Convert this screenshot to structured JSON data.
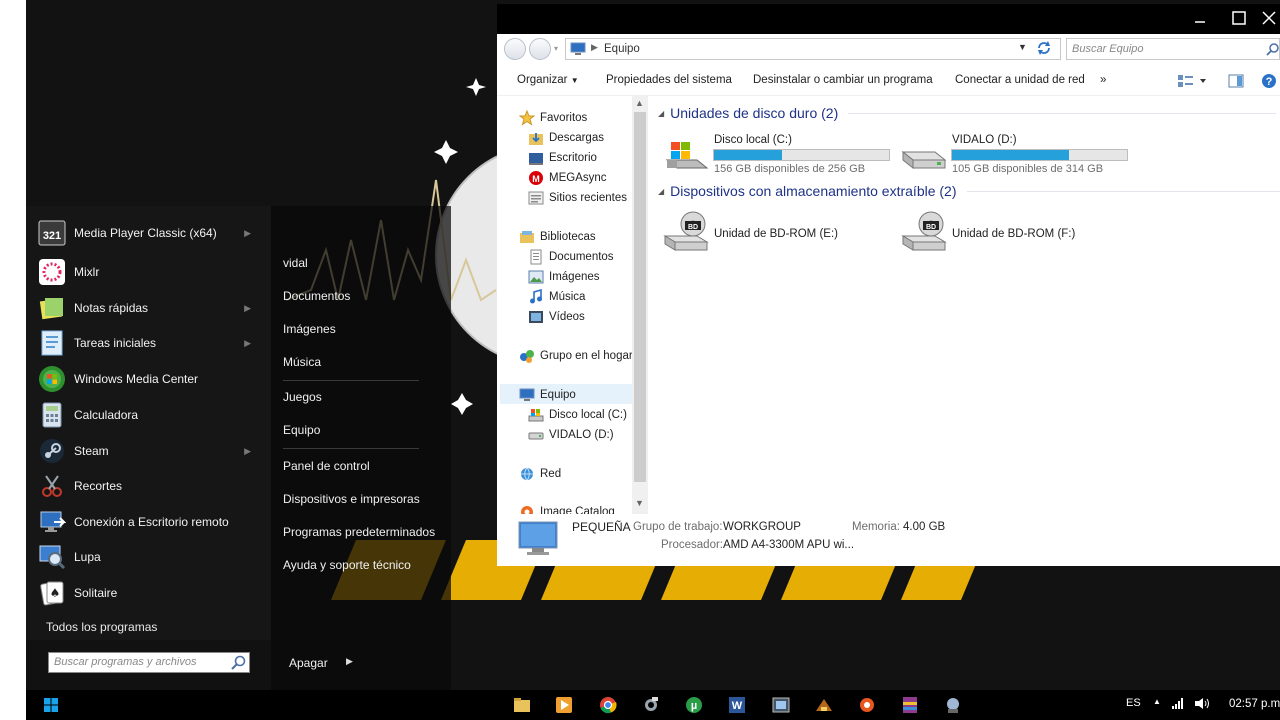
{
  "start_menu": {
    "programs": [
      {
        "label": "Media Player Classic (x64)",
        "icon": "media-player-classic-icon",
        "has_submenu": true
      },
      {
        "label": "Mixlr",
        "icon": "mixlr-icon",
        "has_submenu": false
      },
      {
        "label": "Notas rápidas",
        "icon": "sticky-notes-icon",
        "has_submenu": true
      },
      {
        "label": "Tareas iniciales",
        "icon": "getting-started-icon",
        "has_submenu": true
      },
      {
        "label": "Windows Media Center",
        "icon": "windows-media-center-icon",
        "has_submenu": false
      },
      {
        "label": "Calculadora",
        "icon": "calculator-icon",
        "has_submenu": false
      },
      {
        "label": "Steam",
        "icon": "steam-icon",
        "has_submenu": true
      },
      {
        "label": "Recortes",
        "icon": "snipping-tool-icon",
        "has_submenu": false
      },
      {
        "label": "Conexión a Escritorio remoto",
        "icon": "remote-desktop-icon",
        "has_submenu": false
      },
      {
        "label": "Lupa",
        "icon": "magnifier-icon",
        "has_submenu": false
      },
      {
        "label": "Solitaire",
        "icon": "solitaire-icon",
        "has_submenu": false
      }
    ],
    "all_programs": "Todos los programas",
    "search_placeholder": "Buscar programas y archivos",
    "places": [
      "vidal",
      "Documentos",
      "Imágenes",
      "Música",
      "Juegos",
      "Equipo",
      "Panel de control",
      "Dispositivos e impresoras",
      "Programas predeterminados",
      "Ayuda y soporte técnico"
    ],
    "shutdown": "Apagar"
  },
  "explorer": {
    "address": "Equipo",
    "search_placeholder": "Buscar Equipo",
    "toolbar": {
      "organize": "Organizar",
      "system_properties": "Propiedades del sistema",
      "uninstall": "Desinstalar o cambiar un programa",
      "map_drive": "Conectar a unidad de red",
      "more": "»"
    },
    "nav": {
      "favorites": "Favoritos",
      "downloads": "Descargas",
      "desktop": "Escritorio",
      "megasync": "MEGAsync",
      "recent": "Sitios recientes",
      "libraries": "Bibliotecas",
      "documents": "Documentos",
      "pictures": "Imágenes",
      "music": "Música",
      "videos": "Vídeos",
      "homegroup": "Grupo en el hogar",
      "computer": "Equipo",
      "local_disk": "Disco local (C:)",
      "vidalo": "VIDALO (D:)",
      "network": "Red",
      "image_catalog": "Image Catalog"
    },
    "groups": {
      "hard_drives": "Unidades de disco duro (2)",
      "removable": "Dispositivos con almacenamiento extraíble (2)"
    },
    "drives": [
      {
        "name": "Disco local (C:)",
        "free": "156 GB disponibles de 256 GB",
        "used_fraction": 0.39
      },
      {
        "name": "VIDALO (D:)",
        "free": "105 GB disponibles de 314 GB",
        "used_fraction": 0.67
      }
    ],
    "removable_drives": [
      "Unidad de BD-ROM (E:)",
      "Unidad de BD-ROM (F:)"
    ],
    "bd_label": "BD",
    "details": {
      "name": "PEQUEÑA",
      "workgroup_label": "Grupo de trabajo:",
      "workgroup": "WORKGROUP",
      "memory_label": "Memoria:",
      "memory": "4.00 GB",
      "processor_label": "Procesador:",
      "processor": "AMD A4-3300M APU wi..."
    }
  },
  "taskbar": {
    "language": "ES",
    "time": "02:57 p.m."
  },
  "colors": {
    "accent_blue": "#26a0da",
    "group_header": "#1e3287",
    "wallpaper_yellow": "#f2b705"
  }
}
